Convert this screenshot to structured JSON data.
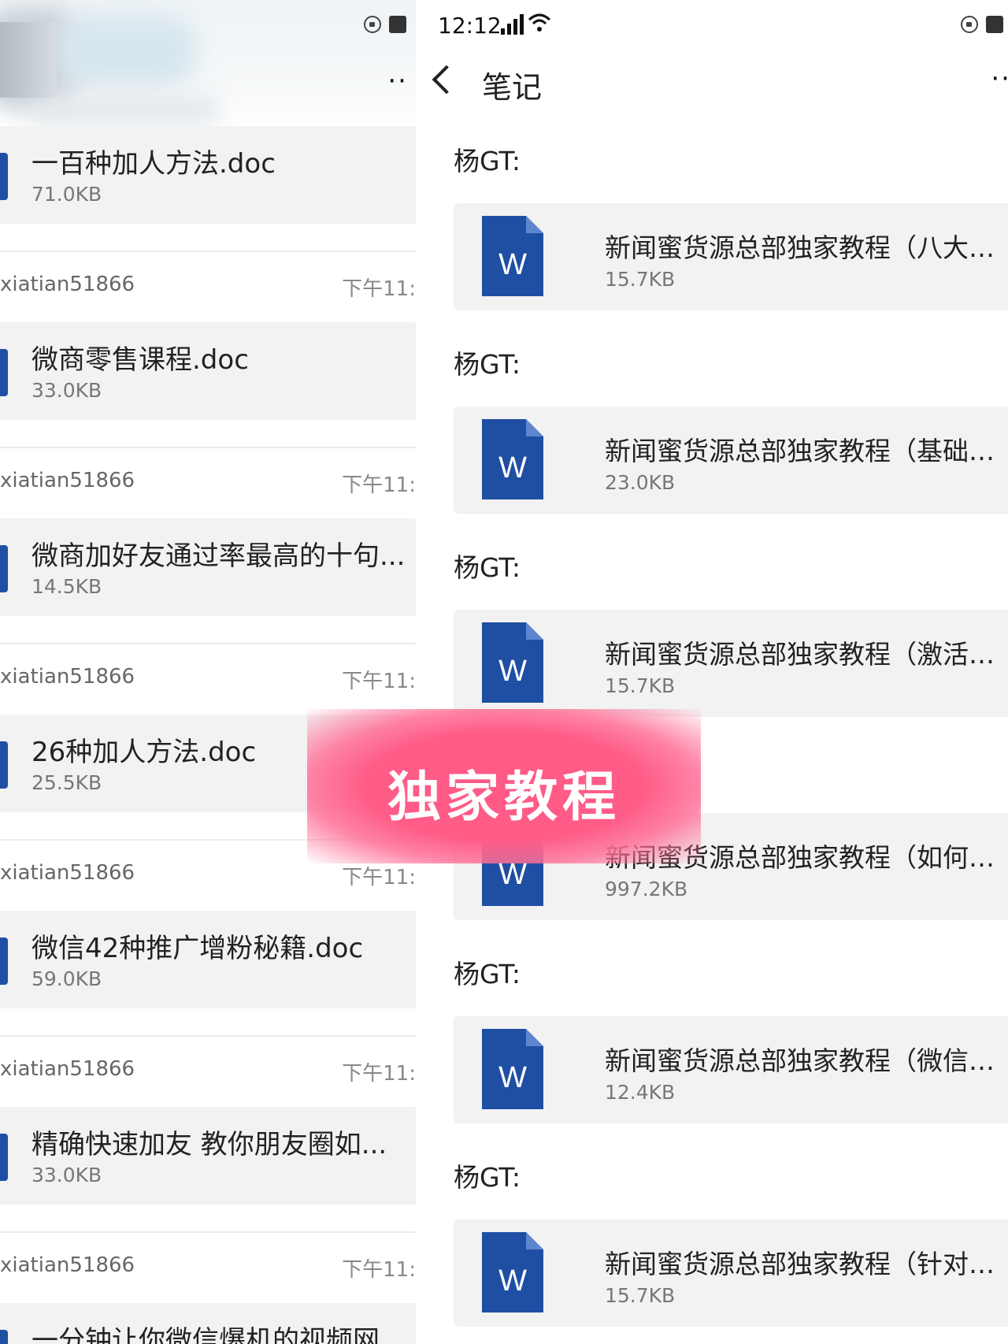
{
  "left": {
    "first_file": {
      "name": "一百种加人方法.doc",
      "size": "71.0KB"
    },
    "entries": [
      {
        "sender": "xiatian51866",
        "time": "下午11:",
        "file": "微商零售课程.doc",
        "size": "33.0KB"
      },
      {
        "sender": "xiatian51866",
        "time": "下午11:",
        "file": "微商加好友通过率最高的十句...",
        "size": "14.5KB"
      },
      {
        "sender": "xiatian51866",
        "time": "下午11:",
        "file": "26种加人方法.doc",
        "size": "25.5KB"
      },
      {
        "sender": "xiatian51866",
        "time": "下午11:",
        "file": "微信42种推广增粉秘籍.doc",
        "size": "59.0KB"
      },
      {
        "sender": "xiatian51866",
        "time": "下午11:",
        "file": "精确快速加友 教你朋友圈如...",
        "size": "33.0KB"
      },
      {
        "sender": "xiatian51866",
        "time": "下午11:",
        "file": "一分钟让你微信爆机的视频网...",
        "size": ""
      }
    ]
  },
  "right": {
    "status": {
      "time": "12:12"
    },
    "nav": {
      "title": "笔记"
    },
    "messages": [
      {
        "sender": "杨GT:",
        "title": "新闻蜜货源总部独家教程（八大重...",
        "size": "15.7KB"
      },
      {
        "sender": "杨GT:",
        "title": "新闻蜜货源总部独家教程（基础篇...",
        "size": "23.0KB"
      },
      {
        "sender": "杨GT:",
        "title": "新闻蜜货源总部独家教程（激活朋...",
        "size": "15.7KB"
      },
      {
        "sender": "",
        "title": "新闻蜜货源总部独家教程（如何打...",
        "size": "997.2KB"
      },
      {
        "sender": "杨GT:",
        "title": "新闻蜜货源总部独家教程（微信防...",
        "size": "12.4KB"
      },
      {
        "sender": "杨GT:",
        "title": "新闻蜜货源总部独家教程（针对意...",
        "size": "15.7KB"
      }
    ],
    "word_icon_letter": "W"
  },
  "overlay": {
    "text": "独家教程"
  },
  "colors": {
    "accent_pink": "#ff5a86",
    "word_blue": "#1f4fa3"
  }
}
